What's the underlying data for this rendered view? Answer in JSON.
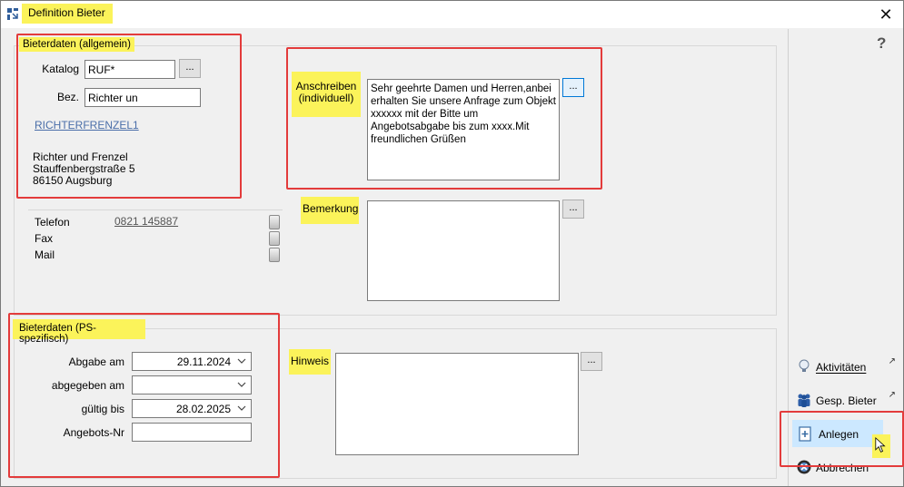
{
  "window": {
    "title": "Definition Bieter",
    "close_glyph": "✕"
  },
  "allgemein": {
    "heading": "Bieterdaten (allgemein)",
    "katalog_label": "Katalog",
    "katalog_value": "RUF*",
    "bez_label": "Bez.",
    "bez_value": "Richter un",
    "link": "RICHTERFRENZEL1",
    "address": [
      "Richter und Frenzel",
      "Stauffenbergstraße 5",
      "86150 Augsburg"
    ],
    "browse": "..."
  },
  "contact": {
    "telefon_label": "Telefon",
    "telefon_value": "0821 145887",
    "fax_label": "Fax",
    "mail_label": "Mail"
  },
  "anschreiben": {
    "label_line1": "Anschreiben",
    "label_line2": "(individuell)",
    "text": "Sehr geehrte Damen und Herren,anbei erhalten Sie unsere Anfrage zum Objekt xxxxxx mit der Bitte um Angebotsabgabe bis zum xxxx.Mit freundlichen Grüßen",
    "browse": "..."
  },
  "bemerkung": {
    "label": "Bemerkung",
    "browse": "..."
  },
  "ps": {
    "heading": "Bieterdaten (PS-spezifisch)",
    "abgabe_label": "Abgabe am",
    "abgabe_value": "29.11.2024",
    "abgegeben_label": "abgegeben am",
    "abgegeben_value": "",
    "gueltig_label": "gültig bis",
    "gueltig_value": "28.02.2025",
    "angebots_label": "Angebots-Nr",
    "angebots_value": ""
  },
  "hinweis": {
    "label": "Hinweis",
    "browse": "..."
  },
  "sidebar": {
    "help": "?",
    "aktivitaeten": "Aktivitäten",
    "gesp_bieter": "Gesp. Bieter",
    "anlegen": "Anlegen",
    "abbrechen": "Abbrechen",
    "ext_glyph": "↗"
  },
  "colors": {
    "highlight": "#fbf35a",
    "annotation_red": "#e33b3b",
    "link": "#4a6ea9",
    "selected": "#cce8ff"
  }
}
